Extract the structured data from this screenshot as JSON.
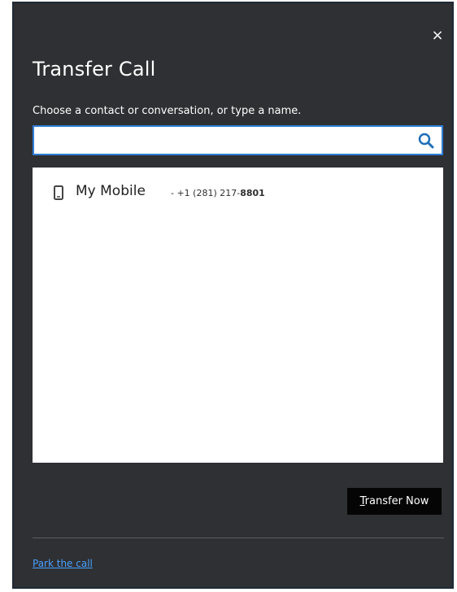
{
  "dialog": {
    "title": "Transfer Call",
    "close_icon": "×",
    "instruction": "Choose a contact or conversation, or type a name.",
    "search": {
      "value": "",
      "placeholder": ""
    },
    "results": [
      {
        "icon": "mobile-phone-icon",
        "name": "My Mobile",
        "number_prefix": "- +1 (281) 217-",
        "number_suffix": "8801"
      }
    ],
    "transfer_button": {
      "accelerator": "T",
      "label_rest": "ransfer Now"
    },
    "park_link": "Park the call"
  },
  "colors": {
    "background": "#2f3033",
    "accent": "#2e7dd4",
    "link": "#48a0ff",
    "button": "#050505"
  }
}
